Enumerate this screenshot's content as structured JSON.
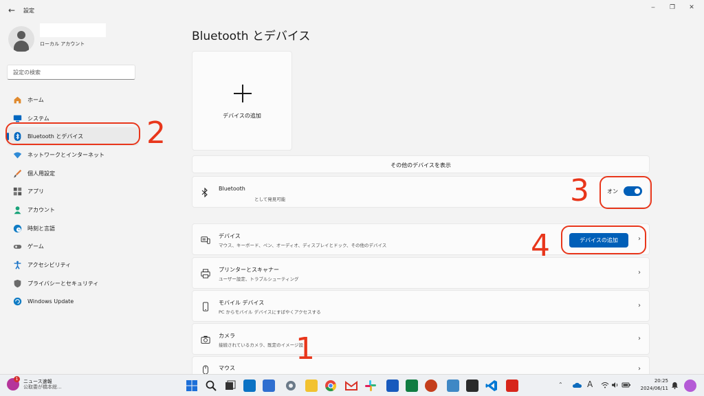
{
  "window": {
    "title": "設定",
    "back_glyph": "←",
    "minimize_glyph": "‒",
    "maximize_glyph": "❐",
    "close_glyph": "✕"
  },
  "profile": {
    "account_type": "ローカル アカウント"
  },
  "search": {
    "placeholder": "設定の検索"
  },
  "sidebar": {
    "items": [
      {
        "label": "ホーム",
        "icon": "home-icon",
        "color": "#e08a2e"
      },
      {
        "label": "システム",
        "icon": "system-icon",
        "color": "#0067c0"
      },
      {
        "label": "Bluetooth とデバイス",
        "icon": "bluetooth-icon",
        "color": "#0067c0"
      },
      {
        "label": "ネットワークとインターネット",
        "icon": "network-icon",
        "color": "#2f8ad6"
      },
      {
        "label": "個人用設定",
        "icon": "brush-icon",
        "color": "#e07b39"
      },
      {
        "label": "アプリ",
        "icon": "apps-icon",
        "color": "#555555"
      },
      {
        "label": "アカウント",
        "icon": "account-icon",
        "color": "#1aa37a"
      },
      {
        "label": "時刻と言語",
        "icon": "clock-globe-icon",
        "color": "#0f7bc4"
      },
      {
        "label": "ゲーム",
        "icon": "gamepad-icon",
        "color": "#6b6b6b"
      },
      {
        "label": "アクセシビリティ",
        "icon": "accessibility-icon",
        "color": "#1a73c7"
      },
      {
        "label": "プライバシーとセキュリティ",
        "icon": "shield-icon",
        "color": "#6b6b6b"
      },
      {
        "label": "Windows Update",
        "icon": "update-icon",
        "color": "#0f7bc4"
      }
    ]
  },
  "main": {
    "title": "Bluetooth とデバイス",
    "add_tile_label": "デバイスの追加",
    "more_devices_link": "その他のデバイスを表示",
    "bluetooth": {
      "title": "Bluetooth",
      "subtitle": "として発見可能",
      "toggle_label": "オン",
      "toggle_on": true
    },
    "rows": [
      {
        "title": "デバイス",
        "subtitle": "マウス、キーボード、ペン、オーディオ、ディスプレイとドック、その他のデバイス",
        "icon": "devices-icon",
        "button": "デバイスの追加"
      },
      {
        "title": "プリンターとスキャナー",
        "subtitle": "ユーザー設定、トラブルシューティング",
        "icon": "printer-icon"
      },
      {
        "title": "モバイル デバイス",
        "subtitle": "PC からモバイル デバイスにすばやくアクセスする",
        "icon": "phone-icon"
      },
      {
        "title": "カメラ",
        "subtitle": "接続されているカメラ、既定のイメージ設",
        "icon": "camera-icon"
      },
      {
        "title": "マウス",
        "subtitle": "",
        "icon": "mouse-icon"
      }
    ],
    "chevron": "›"
  },
  "annotations": [
    "1",
    "2",
    "3",
    "4"
  ],
  "taskbar": {
    "news_title": "ニュース速報",
    "news_sub": "公取委が橋本総...",
    "news_badge": "1",
    "icons": [
      {
        "name": "start-icon",
        "color": "#1d6fd8"
      },
      {
        "name": "search-icon",
        "color": "#222222"
      },
      {
        "name": "task-view-icon",
        "color": "#333333"
      },
      {
        "name": "dell-icon",
        "color": "#0a72c4"
      },
      {
        "name": "store-icon",
        "color": "#2f6fd0"
      },
      {
        "name": "settings-icon",
        "color": "#6b7a89"
      },
      {
        "name": "file-explorer-icon",
        "color": "#f2c230"
      },
      {
        "name": "chrome-icon",
        "color": "#e8453c"
      },
      {
        "name": "gmail-icon",
        "color": "#d93025"
      },
      {
        "name": "slack-icon",
        "color": "#4a154b"
      },
      {
        "name": "word-icon",
        "color": "#185abd"
      },
      {
        "name": "excel-icon",
        "color": "#107c41"
      },
      {
        "name": "powerpoint-icon",
        "color": "#c43e1c"
      },
      {
        "name": "notepad-icon",
        "color": "#3f88c5"
      },
      {
        "name": "terminal-icon",
        "color": "#2b2b2b"
      },
      {
        "name": "vscode-icon",
        "color": "#0078d4"
      },
      {
        "name": "acrobat-icon",
        "color": "#d7261b"
      }
    ],
    "tray": {
      "chevron": "⌃",
      "ime": "A",
      "time": "20:25",
      "date": "2024/06/11"
    }
  }
}
